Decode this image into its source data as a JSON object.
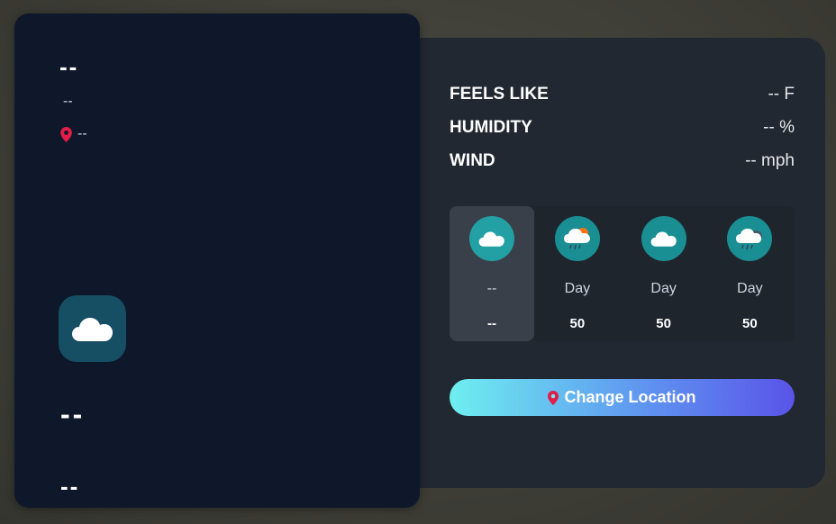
{
  "main_card": {
    "day_name": "--",
    "date": "--",
    "location": "--",
    "icon": "cloud-icon",
    "temperature": "--",
    "description": "--"
  },
  "details": [
    {
      "label": "FEELS LIKE",
      "value": "-- F"
    },
    {
      "label": "HUMIDITY",
      "value": "-- %"
    },
    {
      "label": "WIND",
      "value": "-- mph"
    }
  ],
  "forecast": [
    {
      "day": "--",
      "temp": "--",
      "icon": "cloud-icon"
    },
    {
      "day": "Day",
      "temp": "50",
      "icon": "sun-rain-cloud-icon"
    },
    {
      "day": "Day",
      "temp": "50",
      "icon": "cloud-icon"
    },
    {
      "day": "Day",
      "temp": "50",
      "icon": "storm-cloud-icon"
    }
  ],
  "button": {
    "label": "Change Location",
    "icon": "pin-icon"
  },
  "colors": {
    "card": "#0f172a",
    "panel": "#222831",
    "pin": "#e11d48",
    "icon_bg": "#1a8f93",
    "button_start": "#6eeff0",
    "button_end": "#5a54e8"
  }
}
